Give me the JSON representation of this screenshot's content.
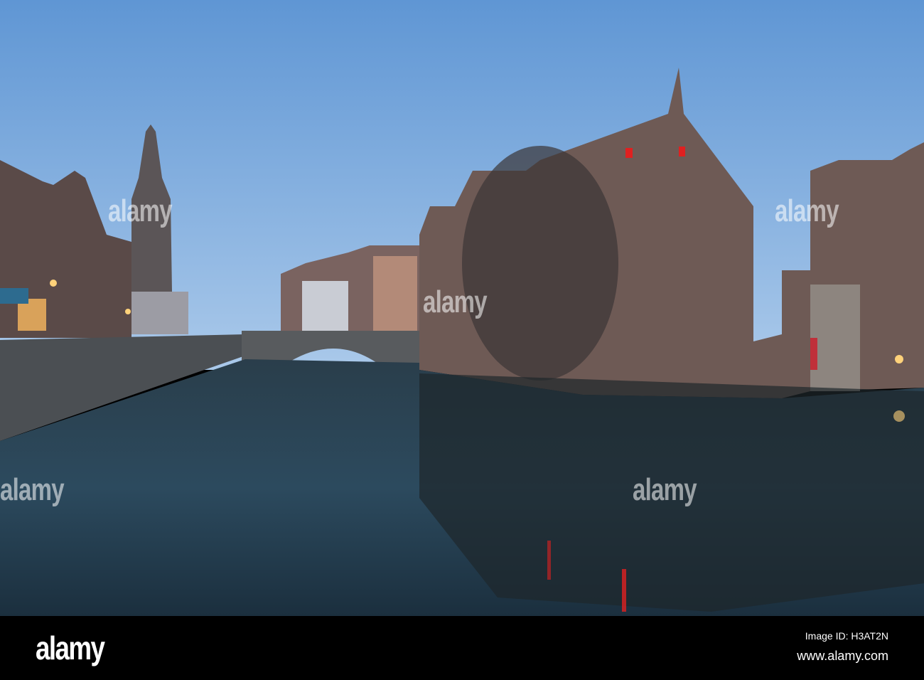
{
  "watermark": {
    "text": "alamy"
  },
  "footer": {
    "logo": "alamy",
    "image_id": "Image ID: H3AT2N",
    "website": "www.alamy.com"
  },
  "colors": {
    "sky_top": "#5f96d4",
    "sky_bottom": "#a9c9ea",
    "water": "#1d3140",
    "brick": "#6e5a55",
    "lamp": "#ffd27a",
    "window_red": "#e02020"
  }
}
